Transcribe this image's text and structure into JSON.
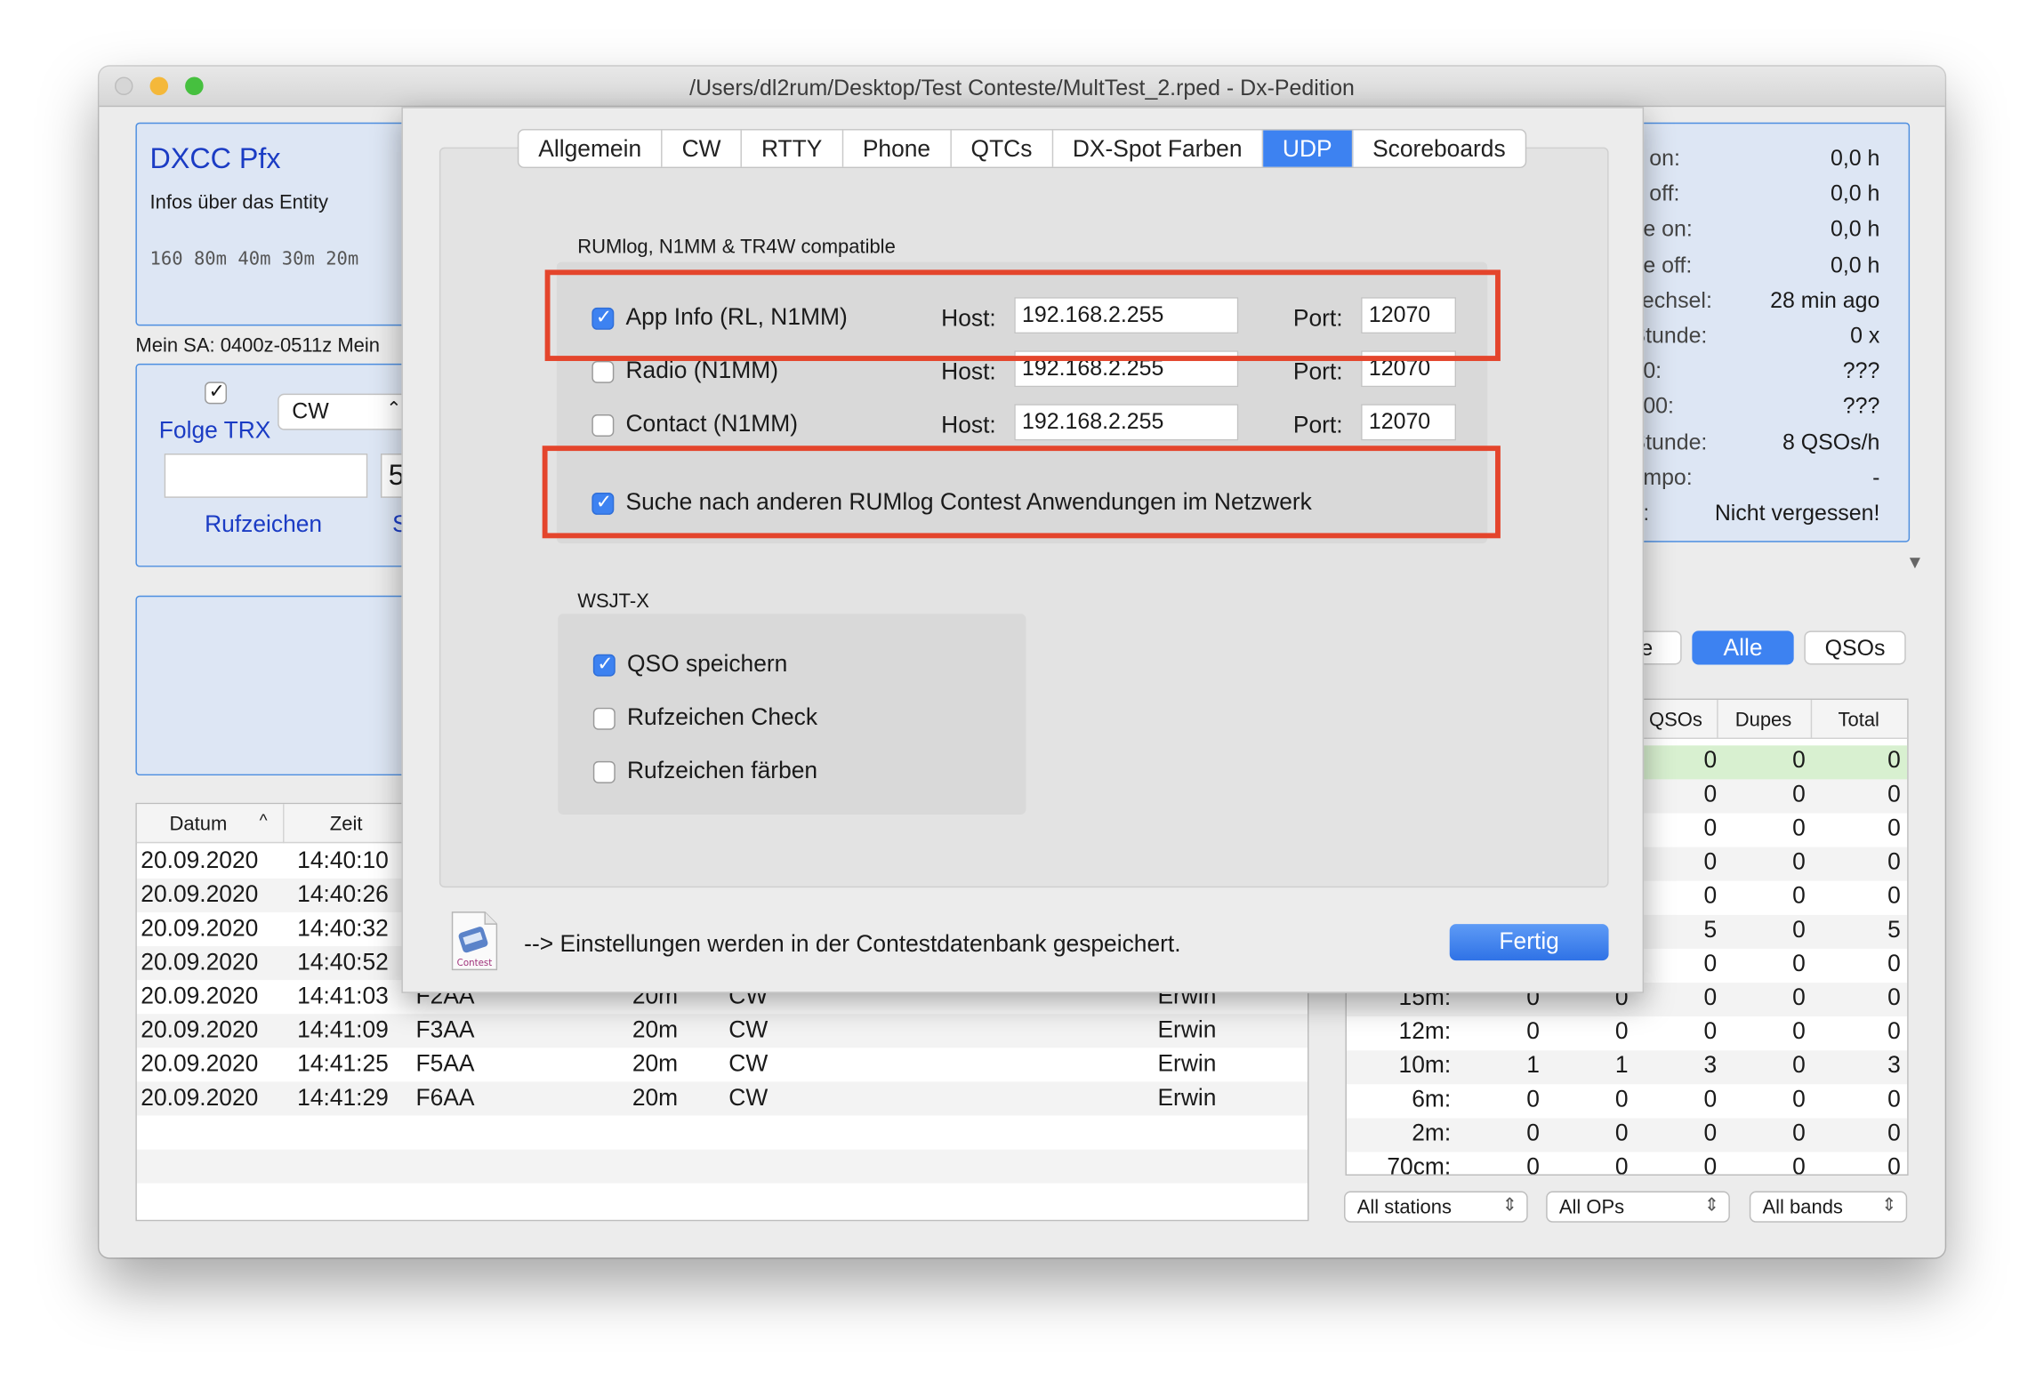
{
  "window": {
    "title": "/Users/dl2rum/Desktop/Test Conteste/MultTest_2.rped - Dx-Pedition"
  },
  "colors": {
    "accent": "#3d82f1",
    "highlight": "#e4452c",
    "panel": "#dde6f4",
    "link": "#1b3cc4"
  },
  "dxcc": {
    "title": "DXCC Pfx",
    "subtitle": "Infos über das Entity",
    "bands": "160 80m 40m 30m 20m"
  },
  "sa_line": "Mein SA: 0400z-0511z  Mein",
  "entry": {
    "follow_label": "Folge TRX",
    "mode": "CW",
    "call_label": "Rufzeichen",
    "next_char": "5",
    "next_label": "S"
  },
  "log": {
    "headers": [
      "Datum",
      "Zeit"
    ],
    "sort_icon": "chevron-up-icon",
    "rows": [
      {
        "date": "20.09.2020",
        "time": "14:40:10",
        "call": "",
        "band": "",
        "mode": "",
        "op": ""
      },
      {
        "date": "20.09.2020",
        "time": "14:40:26",
        "call": "",
        "band": "",
        "mode": "",
        "op": ""
      },
      {
        "date": "20.09.2020",
        "time": "14:40:32",
        "call": "",
        "band": "",
        "mode": "",
        "op": ""
      },
      {
        "date": "20.09.2020",
        "time": "14:40:52",
        "call": "",
        "band": "",
        "mode": "",
        "op": ""
      },
      {
        "date": "20.09.2020",
        "time": "14:41:03",
        "call": "F2AA",
        "band": "20m",
        "mode": "CW",
        "op": "Erwin"
      },
      {
        "date": "20.09.2020",
        "time": "14:41:09",
        "call": "F3AA",
        "band": "20m",
        "mode": "CW",
        "op": "Erwin"
      },
      {
        "date": "20.09.2020",
        "time": "14:41:25",
        "call": "F5AA",
        "band": "20m",
        "mode": "CW",
        "op": "Erwin"
      },
      {
        "date": "20.09.2020",
        "time": "14:41:29",
        "call": "F6AA",
        "band": "20m",
        "mode": "CW",
        "op": "Erwin"
      }
    ]
  },
  "stats": [
    {
      "label": "e on:",
      "value": "0,0 h"
    },
    {
      "label": "e off:",
      "value": "0,0 h"
    },
    {
      "label": "ne on:",
      "value": "0,0 h"
    },
    {
      "label": "ne off:",
      "value": "0,0 h"
    },
    {
      "label": "vechsel:",
      "value": "28 min ago"
    },
    {
      "label": "Stunde:",
      "value": "0 x"
    },
    {
      "label": "10:",
      "value": "???"
    },
    {
      "label": "100:",
      "value": "???"
    },
    {
      "label": "Stunde:",
      "value": "8 QSOs/h"
    },
    {
      "label": "empo:",
      "value": "-"
    },
    {
      "label": "d:",
      "value": "Nicht vergessen!"
    }
  ],
  "filter_buttons": [
    {
      "label": "ne"
    },
    {
      "label": "Alle"
    },
    {
      "label": "QSOs"
    }
  ],
  "band_table": {
    "headers": [
      "QSOs",
      "Dupes",
      "Total"
    ],
    "rows": [
      {
        "band": "",
        "a": "",
        "b": "",
        "qsos": "0",
        "dupes": "0",
        "total": "0"
      },
      {
        "band": "",
        "a": "",
        "b": "",
        "qsos": "0",
        "dupes": "0",
        "total": "0"
      },
      {
        "band": "",
        "a": "",
        "b": "",
        "qsos": "0",
        "dupes": "0",
        "total": "0"
      },
      {
        "band": "",
        "a": "",
        "b": "",
        "qsos": "0",
        "dupes": "0",
        "total": "0"
      },
      {
        "band": "",
        "a": "",
        "b": "",
        "qsos": "0",
        "dupes": "0",
        "total": "0"
      },
      {
        "band": "",
        "a": "",
        "b": "",
        "qsos": "5",
        "dupes": "0",
        "total": "5"
      },
      {
        "band": "",
        "a": "",
        "b": "",
        "qsos": "0",
        "dupes": "0",
        "total": "0"
      },
      {
        "band": "15m:",
        "a": "0",
        "b": "0",
        "qsos": "0",
        "dupes": "0",
        "total": "0"
      },
      {
        "band": "12m:",
        "a": "0",
        "b": "0",
        "qsos": "0",
        "dupes": "0",
        "total": "0"
      },
      {
        "band": "10m:",
        "a": "1",
        "b": "1",
        "qsos": "3",
        "dupes": "0",
        "total": "3"
      },
      {
        "band": "6m:",
        "a": "0",
        "b": "0",
        "qsos": "0",
        "dupes": "0",
        "total": "0"
      },
      {
        "band": "2m:",
        "a": "0",
        "b": "0",
        "qsos": "0",
        "dupes": "0",
        "total": "0"
      },
      {
        "band": "70cm:",
        "a": "0",
        "b": "0",
        "qsos": "0",
        "dupes": "0",
        "total": "0"
      }
    ]
  },
  "bottom_selects": [
    {
      "value": "All stations"
    },
    {
      "value": "All OPs"
    },
    {
      "value": "All bands"
    }
  ],
  "dialog": {
    "tabs": [
      "Allgemein",
      "CW",
      "RTTY",
      "Phone",
      "QTCs",
      "DX-Spot Farben",
      "UDP",
      "Scoreboards"
    ],
    "active_tab": "UDP",
    "section1_title": "RUMlog, N1MM & TR4W compatible",
    "host_label": "Host:",
    "port_label": "Port:",
    "udp_rows": [
      {
        "label": "App Info (RL, N1MM)",
        "checked": true,
        "host": "192.168.2.255",
        "port": "12070"
      },
      {
        "label": "Radio (N1MM)",
        "checked": false,
        "host": "192.168.2.255",
        "port": "12070"
      },
      {
        "label": "Contact (N1MM)",
        "checked": false,
        "host": "192.168.2.255",
        "port": "12070"
      }
    ],
    "search_option": "Suche nach anderen RUMlog Contest Anwendungen im Netzwerk",
    "section2_title": "WSJT-X",
    "wsjt_options": [
      {
        "label": "QSO speichern",
        "checked": true
      },
      {
        "label": "Rufzeichen Check",
        "checked": false
      },
      {
        "label": "Rufzeichen färben",
        "checked": false
      }
    ],
    "footer_note": "--> Einstellungen werden in der Contestdatenbank gespeichert.",
    "doc_icon_label": "Contest",
    "done_button": "Fertig"
  }
}
